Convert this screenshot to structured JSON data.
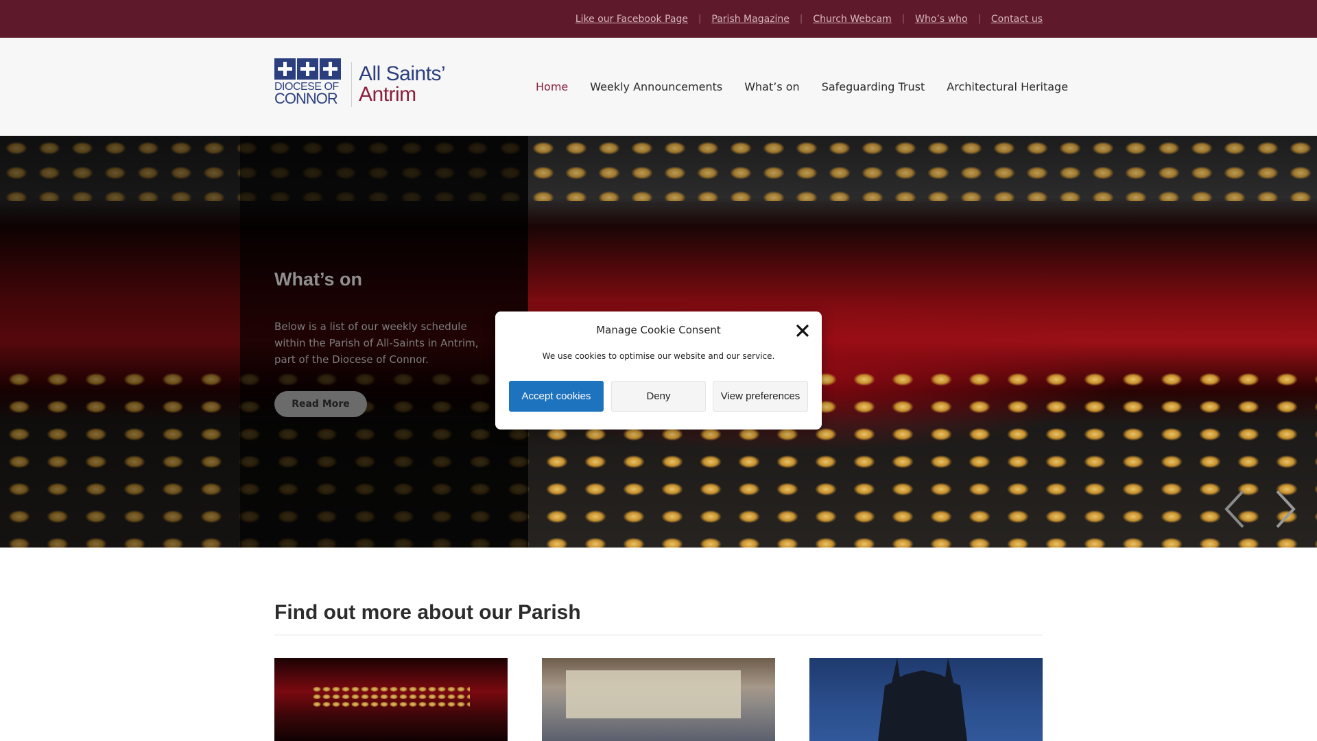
{
  "topbar": {
    "links": [
      "Like our Facebook Page",
      "Parish Magazine",
      "Church Webcam",
      "Who’s who",
      "Contact us"
    ],
    "separator": "|"
  },
  "logo": {
    "diocese_line1": "DIOCESE OF",
    "diocese_line2": "CONNOR",
    "parish_line1": "All Saints’",
    "parish_line2": "Antrim"
  },
  "nav": {
    "items": [
      "Home",
      "Weekly Announcements",
      "What’s on",
      "Safeguarding Trust",
      "Architectural Heritage"
    ],
    "active": "Home"
  },
  "hero": {
    "title": "What’s on",
    "text": "Below is a list of our weekly schedule within the Parish of All-Saints in Antrim, part of the Diocese of Connor.",
    "button": "Read More",
    "prev_icon": "chevron-left-icon",
    "next_icon": "chevron-right-icon"
  },
  "section": {
    "title": "Find out more about our Parish"
  },
  "cookie_modal": {
    "title": "Manage Cookie Consent",
    "text": "We use cookies to optimise our website and our service.",
    "accept": "Accept cookies",
    "deny": "Deny",
    "preferences": "View preferences",
    "close_icon": "close-icon"
  },
  "colors": {
    "topbar_bg": "#5e1a2b",
    "brand_blue": "#2b3f7e",
    "brand_red": "#8a1f3d",
    "accept_button": "#1e73be"
  }
}
